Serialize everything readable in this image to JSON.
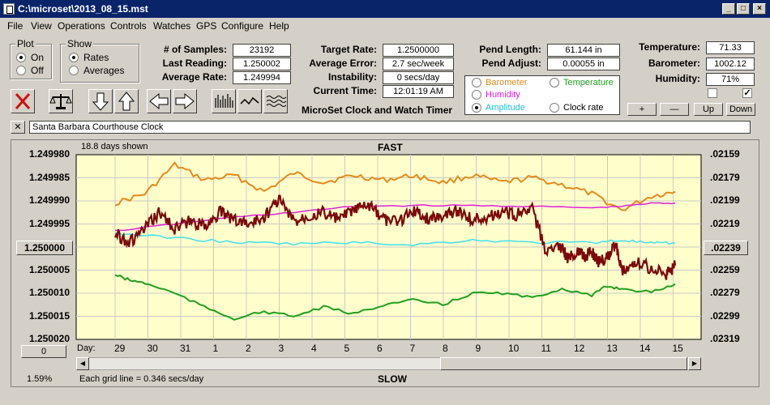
{
  "window": {
    "title": "C:\\microset\\2013_08_15.mst"
  },
  "menu": [
    "File",
    "View",
    "Operations",
    "Controls",
    "Watches",
    "GPS",
    "Configure",
    "Help"
  ],
  "plot_group": {
    "title": "Plot",
    "on_label": "On",
    "off_label": "Off",
    "selected": "On"
  },
  "show_group": {
    "title": "Show",
    "rates_label": "Rates",
    "averages_label": "Averages",
    "selected": "Rates"
  },
  "stats": {
    "samples_label": "# of Samples:",
    "samples_value": "23192",
    "last_reading_label": "Last Reading:",
    "last_reading_value": "1.250002",
    "average_rate_label": "Average Rate:",
    "average_rate_value": "1.249994",
    "target_rate_label": "Target Rate:",
    "target_rate_value": "1.2500000",
    "average_error_label": "Average Error:",
    "average_error_value": "2.7 sec/week",
    "instability_label": "Instability:",
    "instability_value": "0 secs/day",
    "current_time_label": "Current Time:",
    "current_time_value": "12:01:19 AM",
    "pend_length_label": "Pend Length:",
    "pend_length_value": "61.144 in",
    "pend_adjust_label": "Pend Adjust:",
    "pend_adjust_value": "0.00055 in",
    "temperature_label": "Temperature:",
    "temperature_value": "71.33",
    "barometer_label": "Barometer:",
    "barometer_value": "1002.12",
    "humidity_label": "Humidity:",
    "humidity_value": "71%"
  },
  "app_caption": "MicroSet Clock and Watch Timer",
  "series_select": {
    "barometer": "Barometer",
    "temperature": "Temperature",
    "humidity": "Humidity",
    "amplitude": "Amplitude",
    "clock_rate": "Clock rate",
    "selected": "Amplitude"
  },
  "side_buttons": {
    "plus": "+",
    "minus": "—",
    "up": "Up",
    "down": "Down"
  },
  "checkbox_right_checked": true,
  "name_field": {
    "close": "✕",
    "value": "Santa Barbara Courthouse Clock"
  },
  "colors": {
    "plot_bg": "#ffffcc",
    "barometer": "#e68a1c",
    "humidity": "#e020e0",
    "temperature": "#20a020",
    "amplitude": "#40e0f0",
    "rate": "#7a0a0a",
    "grid": "#c8c8c8"
  },
  "chart_data": {
    "type": "line",
    "title": "FAST",
    "bottom_label": "SLOW",
    "days_shown": "18.8 days shown",
    "grid_note": "Each grid line = 0.346 secs/day",
    "percent": "1.59%",
    "day_prefix": "Day:",
    "y_left_ticks": [
      "1.249980",
      "1.249985",
      "1.249990",
      "1.249995",
      "1.250000",
      "1.250005",
      "1.250010",
      "1.250015",
      "1.250020"
    ],
    "y_right_ticks": [
      ".02159",
      ".02179",
      ".02199",
      ".02219",
      ".02239",
      ".02259",
      ".02279",
      ".02299",
      ".02319"
    ],
    "y_left_button": "1.250000",
    "y_right_button": ".02239",
    "x_button": "0",
    "days": [
      "29",
      "30",
      "31",
      "1",
      "2",
      "3",
      "4",
      "5",
      "6",
      "7",
      "8",
      "9",
      "10",
      "11",
      "12",
      "13",
      "14",
      "15"
    ],
    "series": [
      {
        "name": "Barometer",
        "key": "barometer",
        "x": [
          0,
          1,
          2,
          3,
          4,
          5,
          6,
          7,
          8,
          9,
          10,
          11,
          12,
          13,
          14,
          15,
          16,
          17,
          18,
          18.8
        ],
        "y": [
          1.2499905,
          1.2499885,
          1.2499822,
          1.2499855,
          1.2499845,
          1.249988,
          1.249984,
          1.249986,
          1.2499845,
          1.2499855,
          1.2499845,
          1.249986,
          1.2499845,
          1.249986,
          1.249985,
          1.2499865,
          1.2499885,
          1.249992,
          1.249989,
          1.249988
        ]
      },
      {
        "name": "Humidity",
        "key": "humidity",
        "x": [
          0,
          2,
          4,
          6,
          8,
          10,
          12,
          14,
          16,
          17,
          18,
          18.8
        ],
        "y": [
          1.2499965,
          1.249995,
          1.2499935,
          1.2499925,
          1.2499912,
          1.249991,
          1.249991,
          1.2499912,
          1.2499915,
          1.2499912,
          1.2499905,
          1.2499905
        ]
      },
      {
        "name": "Amplitude",
        "key": "amplitude",
        "x": [
          0,
          2,
          4,
          6,
          8,
          10,
          12,
          14,
          16,
          17,
          18,
          18.8
        ],
        "y": [
          1.249997,
          1.249998,
          1.249999,
          1.2499993,
          1.249999,
          1.2499995,
          1.2499985,
          1.249999,
          1.249999,
          1.2499985,
          1.2499992,
          1.2499992
        ]
      },
      {
        "name": "Temperature",
        "key": "temperature",
        "x": [
          0,
          0.5,
          1,
          2,
          3,
          4,
          5,
          6,
          7,
          8,
          9,
          10,
          11,
          12,
          13,
          14,
          15,
          16,
          16.5,
          17,
          18,
          18.8
        ],
        "y": [
          1.250006,
          1.2500072,
          1.2500078,
          1.25001,
          1.250013,
          1.2500155,
          1.250014,
          1.250015,
          1.250013,
          1.2500145,
          1.2500125,
          1.2500115,
          1.2500125,
          1.25001,
          1.25001,
          1.250011,
          1.250009,
          1.2500105,
          1.2500085,
          1.250009,
          1.2500098,
          1.250008
        ]
      },
      {
        "name": "Clock rate",
        "key": "rate",
        "x": [
          0,
          0.5,
          1,
          1.5,
          2,
          2.5,
          3,
          3.5,
          4,
          4.5,
          5,
          5.5,
          6,
          6.5,
          7,
          7.5,
          8,
          8.5,
          9,
          9.5,
          10,
          10.5,
          11,
          11.5,
          12,
          12.5,
          13,
          13.5,
          14,
          14.5,
          15,
          15.2,
          15.5,
          15.8,
          16,
          16.2,
          16.5,
          16.8,
          17,
          17.5,
          18,
          18.5,
          18.8
        ],
        "y": [
          1.249997,
          1.249999,
          1.249996,
          1.2499925,
          1.249996,
          1.2499945,
          1.2499955,
          1.2499925,
          1.249994,
          1.249995,
          1.2499935,
          1.2499895,
          1.2499945,
          1.249993,
          1.2499925,
          1.249994,
          1.249992,
          1.249991,
          1.249994,
          1.2499945,
          1.249992,
          1.249994,
          1.249993,
          1.249992,
          1.249994,
          1.2499935,
          1.2499925,
          1.249993,
          1.249992,
          1.2500015,
          1.25,
          1.2500025,
          1.250001,
          1.250002,
          1.250001,
          1.250003,
          1.2500025,
          1.2499995,
          1.250005,
          1.2500035,
          1.2500045,
          1.250006,
          1.250004
        ]
      }
    ]
  }
}
